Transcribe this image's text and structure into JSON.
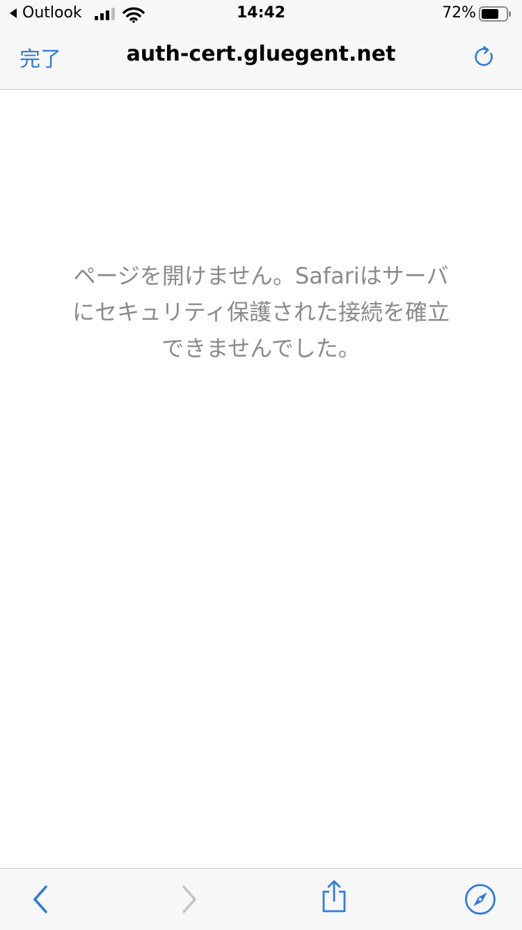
{
  "status_bar": {
    "back_app": "Outlook",
    "time": "14:42",
    "battery_percent": "72%",
    "battery_level": 0.72
  },
  "nav": {
    "done_label": "完了",
    "url": "auth-cert.gluegent.net"
  },
  "content": {
    "error_message": "ページを開けません。Safariはサーバ\nにセキュリティ保護された接続を確立\nできませんでした。"
  },
  "icons": {
    "back": "chevron-left-icon",
    "forward": "chevron-right-icon",
    "share": "share-icon",
    "safari": "compass-icon",
    "reload": "reload-icon"
  },
  "colors": {
    "accent": "#2f7be0",
    "disabled": "#c4c4c6",
    "message_text": "#8a8a8e"
  }
}
